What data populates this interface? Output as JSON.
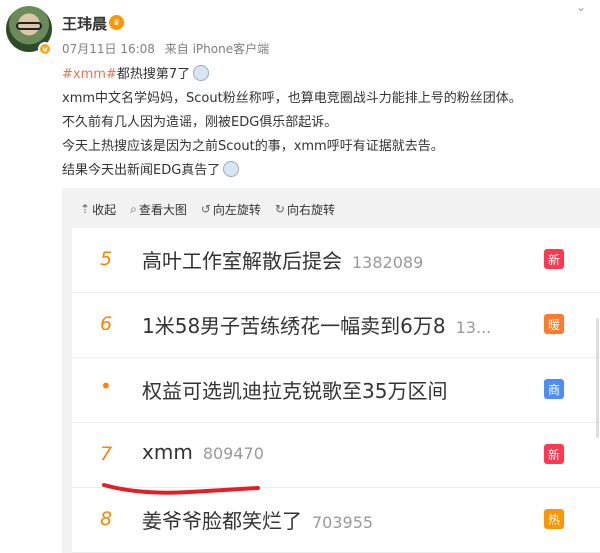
{
  "user": {
    "name": "王玮晨",
    "time": "07月11日 16:08",
    "source": "来自 iPhone客户端"
  },
  "post": {
    "hashtag": "#xmm#",
    "line1_rest": "都热搜第7了",
    "line2": "xmm中文名学妈妈，Scout粉丝称呼，也算电竞圈战斗力能排上号的粉丝团体。",
    "line3": "不久前有几人因为造谣，刚被EDG俱乐部起诉。",
    "line4": "今天上热搜应该是因为之前Scout的事，xmm呼吁有证据就去告。",
    "line5": "结果今天出新闻EDG真告了"
  },
  "toolbar": {
    "collapse": "收起",
    "view_large": "查看大图",
    "rotate_left": "向左旋转",
    "rotate_right": "向右旋转"
  },
  "hot_list": [
    {
      "rank": "5",
      "title": "高叶工作室解散后提会",
      "count": "1382089",
      "tag": "新",
      "tag_color": "#ff3852"
    },
    {
      "rank": "6",
      "title": "1米58男子苦练绣花一幅卖到6万8",
      "count": "13...",
      "tag": "暖",
      "tag_color": "#ff7a2b"
    },
    {
      "rank": "•",
      "title": "权益可选凯迪拉克锐歌至35万区间",
      "count": "",
      "tag": "商",
      "tag_color": "#4c8ef7"
    },
    {
      "rank": "7",
      "title": "xmm",
      "count": "809470",
      "tag": "新",
      "tag_color": "#ff3852"
    },
    {
      "rank": "8",
      "title": "姜爷爷脸都笑烂了",
      "count": "703955",
      "tag": "热",
      "tag_color": "#ff9406"
    }
  ]
}
